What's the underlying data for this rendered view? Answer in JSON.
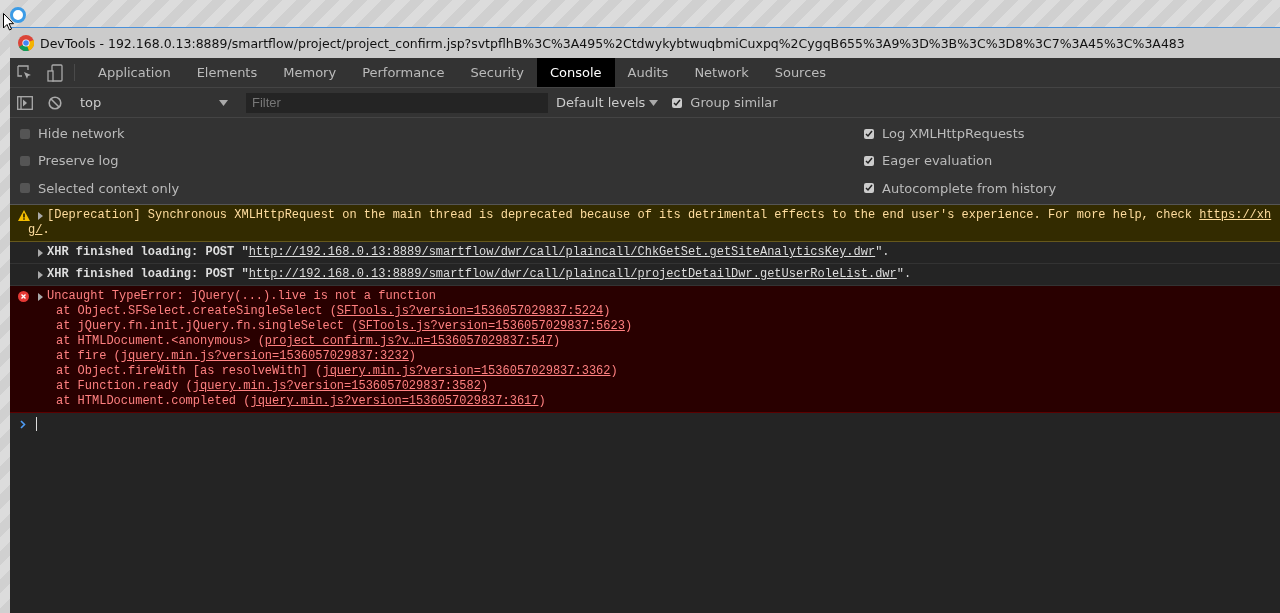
{
  "window": {
    "title": "DevTools - 192.168.0.13:8889/smartflow/project/project_confirm.jsp?svtpflhB%3C%3A495%2CtdwykybtwuqbmiCuxpq%2CygqB655%3A9%3D%3B%3C%3D8%3C7%3A45%3C%3A483"
  },
  "tabs": [
    {
      "label": "Application",
      "selected": false
    },
    {
      "label": "Elements",
      "selected": false
    },
    {
      "label": "Memory",
      "selected": false
    },
    {
      "label": "Performance",
      "selected": false
    },
    {
      "label": "Security",
      "selected": false
    },
    {
      "label": "Console",
      "selected": true
    },
    {
      "label": "Audits",
      "selected": false
    },
    {
      "label": "Network",
      "selected": false
    },
    {
      "label": "Sources",
      "selected": false
    }
  ],
  "console_toolbar": {
    "context": "top",
    "filter": {
      "placeholder": "Filter"
    },
    "levels": "Default levels",
    "group_similar": {
      "label": "Group similar",
      "checked": true
    }
  },
  "settings": {
    "left": [
      {
        "label": "Hide network",
        "checked": false
      },
      {
        "label": "Preserve log",
        "checked": false
      },
      {
        "label": "Selected context only",
        "checked": false
      }
    ],
    "right": [
      {
        "label": "Log XMLHttpRequests",
        "checked": true
      },
      {
        "label": "Eager evaluation",
        "checked": true
      },
      {
        "label": "Autocomplete from history",
        "checked": true
      }
    ]
  },
  "messages": [
    {
      "kind": "warning",
      "text": "[Deprecation] Synchronous XMLHttpRequest on the main thread is deprecated because of its detrimental effects to the end user's experience. For more help, check ",
      "link": "https://xh",
      "continuation_link": "g/",
      "continuation_text": "."
    },
    {
      "kind": "info",
      "text": "XHR finished loading: POST \"",
      "link": "http://192.168.0.13:8889/smartflow/dwr/call/plaincall/ChkGetSet.getSiteAnalyticsKey.dwr",
      "end": "\"."
    },
    {
      "kind": "info",
      "text": "XHR finished loading: POST \"",
      "link": "http://192.168.0.13:8889/smartflow/dwr/call/plaincall/projectDetailDwr.getUserRoleList.dwr",
      "end": "\"."
    },
    {
      "kind": "error",
      "text": "Uncaught TypeError: jQuery(...).live is not a function",
      "stack": [
        {
          "text": "at Object.SFSelect.createSingleSelect (",
          "link": "SFTools.js?version=1536057029837:5224",
          "end": ")"
        },
        {
          "text": "at jQuery.fn.init.jQuery.fn.singleSelect (",
          "link": "SFTools.js?version=1536057029837:5623",
          "end": ")"
        },
        {
          "text": "at HTMLDocument.<anonymous> (",
          "link": "project_confirm.js?v…n=1536057029837:547",
          "end": ")"
        },
        {
          "text": "at fire (",
          "link": "jquery.min.js?version=1536057029837:3232",
          "end": ")"
        },
        {
          "text": "at Object.fireWith [as resolveWith] (",
          "link": "jquery.min.js?version=1536057029837:3362",
          "end": ")"
        },
        {
          "text": "at Function.ready (",
          "link": "jquery.min.js?version=1536057029837:3582",
          "end": ")"
        },
        {
          "text": "at HTMLDocument.completed (",
          "link": "jquery.min.js?version=1536057029837:3617",
          "end": ")"
        }
      ]
    }
  ]
}
